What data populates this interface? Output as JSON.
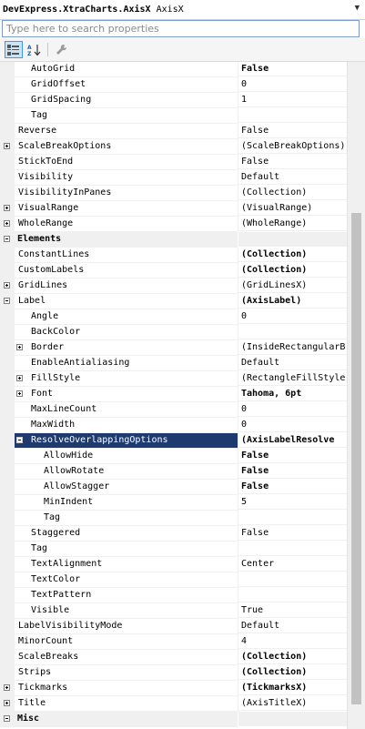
{
  "header": {
    "title": "DevExpress.XtraCharts.AxisX",
    "subtitle": "AxisX"
  },
  "search": {
    "placeholder": "Type here to search properties"
  },
  "rows": [
    {
      "label": "AutoGrid",
      "value": "False",
      "level": 1,
      "bold": true
    },
    {
      "label": "GridOffset",
      "value": "0",
      "level": 1
    },
    {
      "label": "GridSpacing",
      "value": "1",
      "level": 1
    },
    {
      "label": "Tag",
      "value": "",
      "level": 1
    },
    {
      "label": "Reverse",
      "value": "False",
      "level": 0
    },
    {
      "label": "ScaleBreakOptions",
      "value": "(ScaleBreakOptions)",
      "level": 0,
      "expander": "plus"
    },
    {
      "label": "StickToEnd",
      "value": "False",
      "level": 0
    },
    {
      "label": "Visibility",
      "value": "Default",
      "level": 0
    },
    {
      "label": "VisibilityInPanes",
      "value": "(Collection)",
      "level": 0
    },
    {
      "label": "VisualRange",
      "value": "(VisualRange)",
      "level": 0,
      "expander": "plus"
    },
    {
      "label": "WholeRange",
      "value": "(WholeRange)",
      "level": 0,
      "expander": "plus"
    },
    {
      "label": "Elements",
      "value": "",
      "level": 0,
      "category": true,
      "expander": "minus"
    },
    {
      "label": "ConstantLines",
      "value": "(Collection)",
      "level": 0,
      "bold": true
    },
    {
      "label": "CustomLabels",
      "value": "(Collection)",
      "level": 0,
      "bold": true
    },
    {
      "label": "GridLines",
      "value": "(GridLinesX)",
      "level": 0,
      "expander": "plus"
    },
    {
      "label": "Label",
      "value": "(AxisLabel)",
      "level": 0,
      "expander": "minus",
      "bold": true
    },
    {
      "label": "Angle",
      "value": "0",
      "level": 1
    },
    {
      "label": "BackColor",
      "value": "",
      "level": 1
    },
    {
      "label": "Border",
      "value": "(InsideRectangularB",
      "level": 1,
      "expander": "plus"
    },
    {
      "label": "EnableAntialiasing",
      "value": "Default",
      "level": 1
    },
    {
      "label": "FillStyle",
      "value": "(RectangleFillStyle",
      "level": 1,
      "expander": "plus"
    },
    {
      "label": "Font",
      "value": "Tahoma, 6pt",
      "level": 1,
      "expander": "plus",
      "bold": true
    },
    {
      "label": "MaxLineCount",
      "value": "0",
      "level": 1
    },
    {
      "label": "MaxWidth",
      "value": "0",
      "level": 1
    },
    {
      "label": "ResolveOverlappingOptions",
      "value": "(AxisLabelResolve",
      "level": 1,
      "expander": "minus",
      "selected": true,
      "bold": true
    },
    {
      "label": "AllowHide",
      "value": "False",
      "level": 2,
      "bold": true
    },
    {
      "label": "AllowRotate",
      "value": "False",
      "level": 2,
      "bold": true
    },
    {
      "label": "AllowStagger",
      "value": "False",
      "level": 2,
      "bold": true
    },
    {
      "label": "MinIndent",
      "value": "5",
      "level": 2
    },
    {
      "label": "Tag",
      "value": "",
      "level": 2
    },
    {
      "label": "Staggered",
      "value": "False",
      "level": 1
    },
    {
      "label": "Tag",
      "value": "",
      "level": 1
    },
    {
      "label": "TextAlignment",
      "value": "Center",
      "level": 1
    },
    {
      "label": "TextColor",
      "value": "",
      "level": 1
    },
    {
      "label": "TextPattern",
      "value": "",
      "level": 1
    },
    {
      "label": "Visible",
      "value": "True",
      "level": 1
    },
    {
      "label": "LabelVisibilityMode",
      "value": "Default",
      "level": 0
    },
    {
      "label": "MinorCount",
      "value": "4",
      "level": 0
    },
    {
      "label": "ScaleBreaks",
      "value": "(Collection)",
      "level": 0,
      "bold": true
    },
    {
      "label": "Strips",
      "value": "(Collection)",
      "level": 0,
      "bold": true
    },
    {
      "label": "Tickmarks",
      "value": "(TickmarksX)",
      "level": 0,
      "expander": "plus",
      "bold": true
    },
    {
      "label": "Title",
      "value": "(AxisTitleX)",
      "level": 0,
      "expander": "plus"
    },
    {
      "label": "Misc",
      "value": "",
      "level": 0,
      "category": true,
      "expander": "minus"
    }
  ],
  "colors": {
    "selection": "#1e3a6e",
    "category": "#f0f0f0",
    "accent": "#3399ff"
  }
}
